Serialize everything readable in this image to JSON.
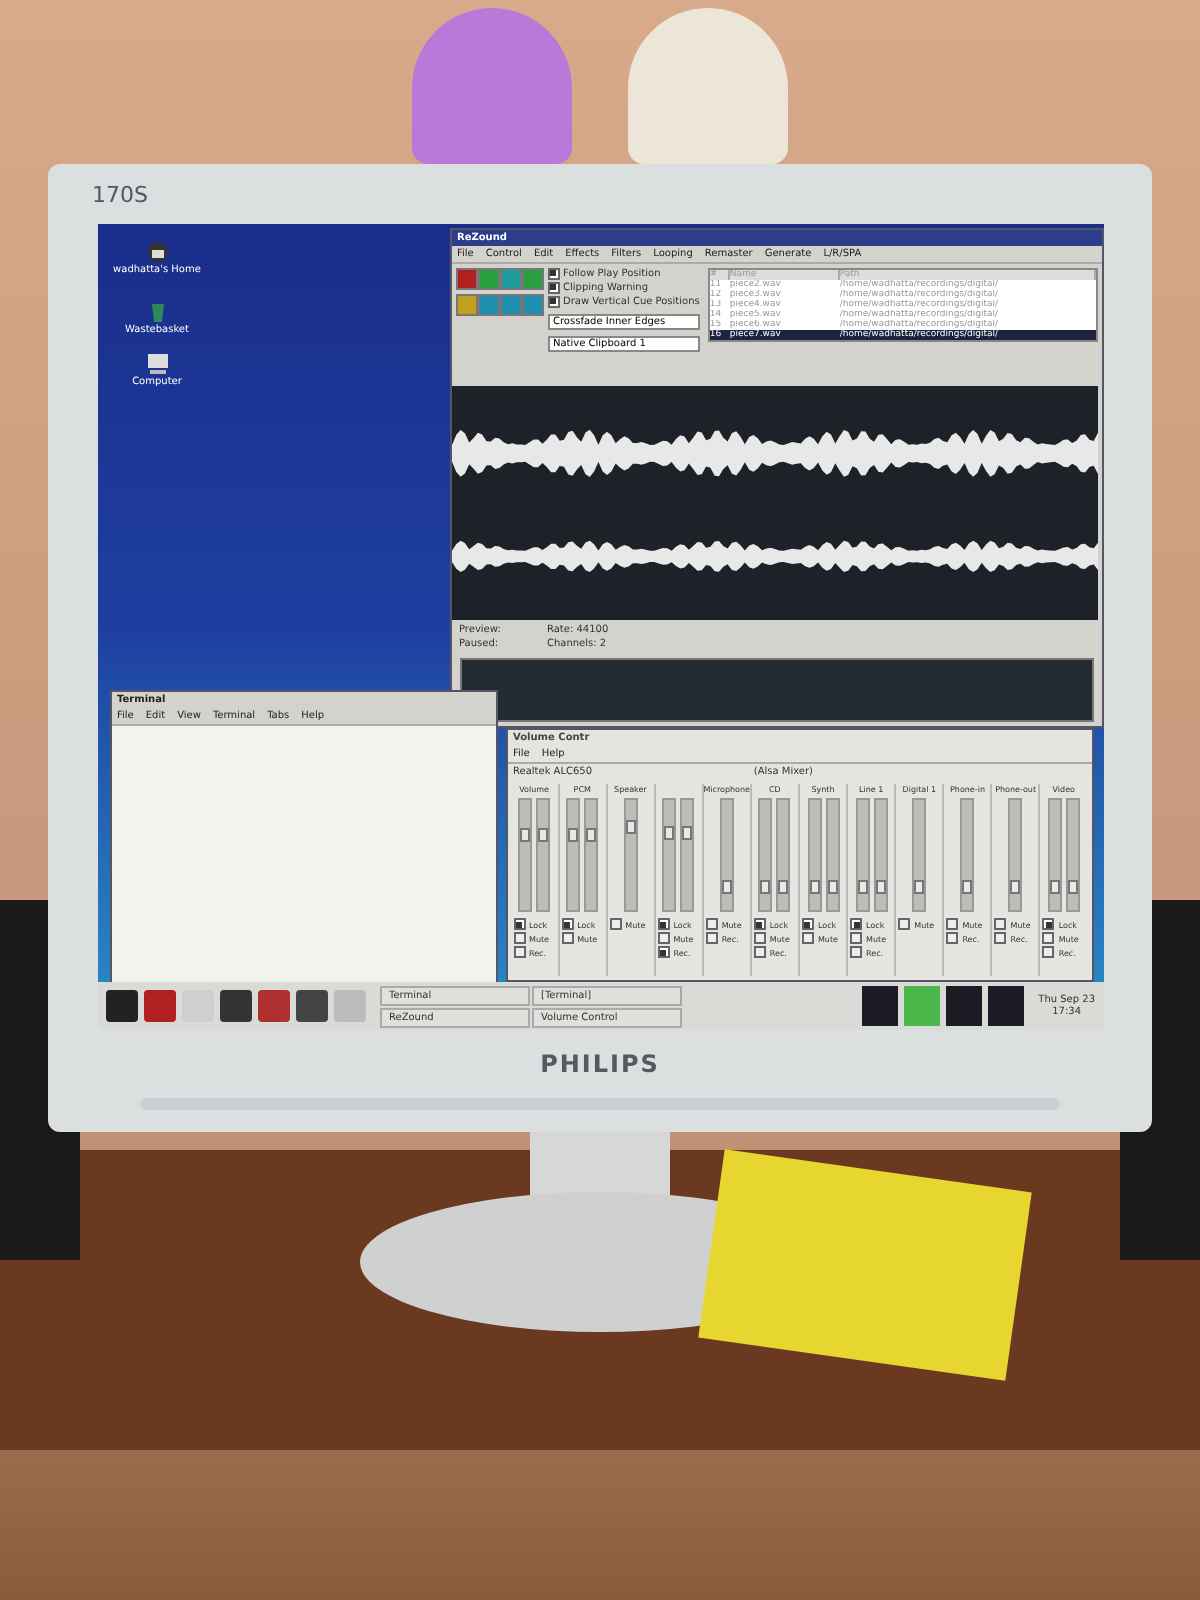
{
  "monitor": {
    "model": "170S",
    "brand": "PHILIPS"
  },
  "desktop_icons": [
    {
      "kind": "home",
      "label": "wadhatta's Home"
    },
    {
      "kind": "trash",
      "label": "Wastebasket"
    },
    {
      "kind": "computer",
      "label": "Computer"
    }
  ],
  "rezound": {
    "title": "ReZound",
    "menu": [
      "File",
      "Control",
      "Edit",
      "Effects",
      "Filters",
      "Looping",
      "Remaster",
      "Generate",
      "L/R/SPA"
    ],
    "options": [
      {
        "label": "Follow Play Position",
        "checked": true
      },
      {
        "label": "Clipping Warning",
        "checked": true
      },
      {
        "label": "Draw Vertical Cue Positions",
        "checked": true
      }
    ],
    "dropdowns": [
      "Crossfade Inner Edges",
      "Native Clipboard 1"
    ],
    "file_list": {
      "columns": [
        "#",
        "Name",
        "Path"
      ],
      "rows": [
        {
          "number": "11",
          "name": "piece2.wav",
          "path": "/home/wadhatta/recordings/digital/",
          "selected": false
        },
        {
          "number": "12",
          "name": "piece3.wav",
          "path": "/home/wadhatta/recordings/digital/",
          "selected": false
        },
        {
          "number": "13",
          "name": "piece4.wav",
          "path": "/home/wadhatta/recordings/digital/",
          "selected": false
        },
        {
          "number": "14",
          "name": "piece5.wav",
          "path": "/home/wadhatta/recordings/digital/",
          "selected": false
        },
        {
          "number": "15",
          "name": "piece6.wav",
          "path": "/home/wadhatta/recordings/digital/",
          "selected": false
        },
        {
          "number": "16",
          "name": "piece7.wav",
          "path": "/home/wadhatta/recordings/digital/",
          "selected": true
        }
      ]
    },
    "status": [
      "Preview:",
      "Rate: 44100",
      "Paused:",
      "Channels: 2"
    ]
  },
  "terminal": {
    "title": "Terminal",
    "menu": [
      "File",
      "Edit",
      "View",
      "Terminal",
      "Tabs",
      "Help"
    ]
  },
  "volume_control": {
    "title": "Volume Contr",
    "menu": [
      "File",
      "Help"
    ],
    "device_start": "Realtek ALC650",
    "device_end": "(Alsa Mixer)",
    "channels": [
      {
        "name": "Volume",
        "sliders": [
          {
            "level": 0.72
          },
          {
            "level": 0.72
          }
        ],
        "toggles": [
          {
            "label": "Lock",
            "checked": true
          },
          {
            "label": "Mute",
            "checked": false
          },
          {
            "label": "Rec.",
            "checked": false
          }
        ]
      },
      {
        "name": "PCM",
        "sliders": [
          {
            "level": 0.72
          },
          {
            "level": 0.72
          }
        ],
        "toggles": [
          {
            "label": "Lock",
            "checked": true
          },
          {
            "label": "Mute",
            "checked": false
          }
        ]
      },
      {
        "name": "Speaker",
        "sliders": [
          {
            "level": 0.8
          }
        ],
        "toggles": [
          {
            "label": "Mute",
            "checked": false
          }
        ]
      },
      {
        "sliders": [
          {
            "level": 0.75
          },
          {
            "level": 0.75
          }
        ],
        "toggles": [
          {
            "label": "Lock",
            "checked": true
          },
          {
            "label": "Mute",
            "checked": false
          },
          {
            "label": "Rec.",
            "checked": true
          }
        ]
      },
      {
        "name": "Microphone",
        "sliders": [
          {
            "level": 0.2
          }
        ],
        "toggles": [
          {
            "label": "Mute",
            "checked": false
          },
          {
            "label": "Rec.",
            "checked": false
          }
        ]
      },
      {
        "name": "CD",
        "sliders": [
          {
            "level": 0.2
          },
          {
            "level": 0.2
          }
        ],
        "toggles": [
          {
            "label": "Lock",
            "checked": true
          },
          {
            "label": "Mute",
            "checked": false
          },
          {
            "label": "Rec.",
            "checked": false
          }
        ]
      },
      {
        "name": "Synth",
        "sliders": [
          {
            "level": 0.2
          },
          {
            "level": 0.2
          }
        ],
        "toggles": [
          {
            "label": "Lock",
            "checked": true
          },
          {
            "label": "Mute",
            "checked": false
          }
        ]
      },
      {
        "name": "Line 1",
        "sliders": [
          {
            "level": 0.2
          },
          {
            "level": 0.2
          }
        ],
        "toggles": [
          {
            "label": "Lock",
            "checked": true
          },
          {
            "label": "Mute",
            "checked": false
          },
          {
            "label": "Rec.",
            "checked": false
          }
        ]
      },
      {
        "name": "Digital 1",
        "sliders": [
          {
            "level": 0.2
          }
        ],
        "toggles": [
          {
            "label": "Mute",
            "checked": false
          }
        ]
      },
      {
        "name": "Phone-in",
        "sliders": [
          {
            "level": 0.2
          }
        ],
        "toggles": [
          {
            "label": "Mute",
            "checked": false
          },
          {
            "label": "Rec.",
            "checked": false
          }
        ]
      },
      {
        "name": "Phone-out",
        "sliders": [
          {
            "level": 0.2
          }
        ],
        "toggles": [
          {
            "label": "Mute",
            "checked": false
          },
          {
            "label": "Rec.",
            "checked": false
          }
        ]
      },
      {
        "name": "Video",
        "sliders": [
          {
            "level": 0.2
          },
          {
            "level": 0.2
          }
        ],
        "toggles": [
          {
            "label": "Lock",
            "checked": true
          },
          {
            "label": "Mute",
            "checked": false
          },
          {
            "label": "Rec.",
            "checked": false
          }
        ]
      }
    ]
  },
  "taskbar": {
    "tasks": [
      {
        "label": "Terminal",
        "selected": false
      },
      {
        "label": "ReZound",
        "selected": false
      },
      {
        "label": "[Terminal]",
        "selected": false
      },
      {
        "label": "Volume Control",
        "selected": false
      }
    ],
    "workspaces": [
      {
        "selected": false
      },
      {
        "selected": true
      },
      {
        "selected": false
      },
      {
        "selected": false
      }
    ],
    "clock": {
      "date": "Thu Sep 23",
      "time": "17:34"
    }
  }
}
